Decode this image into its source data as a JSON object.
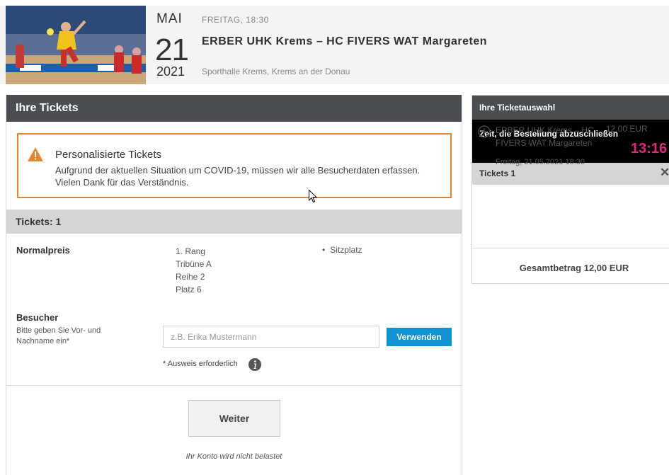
{
  "event": {
    "month": "MAI",
    "day": "21",
    "year": "2021",
    "time": "FREITAG, 18:30",
    "title": "ERBER UHK Krems – HC FIVERS WAT Margareten",
    "venue": "Sporthalle Krems, Krems an der Donau",
    "image_icon": "handball-photo"
  },
  "tickets_panel": {
    "title": "Ihre Tickets",
    "notice": {
      "icon": "warning-icon",
      "title": "Personalisierte Tickets",
      "text": "Aufgrund der aktuellen Situation um COVID-19, müssen wir alle Besucherdaten erfassen. Vielen Dank für das Verständnis."
    },
    "tickets_label": "Tickets: 1",
    "ticket": {
      "price_type": "Normalpreis",
      "seat_lines": [
        "1. Rang",
        "Tribüne A",
        "Reihe 2",
        "Platz 6"
      ],
      "seat_type": "Sitzplatz"
    },
    "visitor": {
      "label": "Besucher",
      "hint": "Bitte geben Sie Vor- und Nachname ein*",
      "input_value": "",
      "input_placeholder": "z.B. Erika Mustermann",
      "use_button": "Verwenden",
      "id_note": "* Ausweis erforderlich"
    },
    "next_button": "Weiter",
    "account_note": "Ihr Konto wird nicht belastet"
  },
  "selection_panel": {
    "title": "Ihre Ticketauswahl",
    "timer_label": "Zeit, die Bestellung abzuschließen",
    "timer_value": "13:16",
    "tickets_label": "Tickets 1",
    "item": {
      "name": "ERBER UHK Krems – HC FIVERS WAT Margareten",
      "price": "12,00 EUR",
      "date": "Freitag, 21.05.2021 18:30"
    },
    "total": "Gesamtbetrag 12,00 EUR"
  },
  "colors": {
    "header_dark": "#4a4e52",
    "notice_border": "#e8852c",
    "button_blue": "#1193d4",
    "timer_pink": "#e0287a"
  }
}
